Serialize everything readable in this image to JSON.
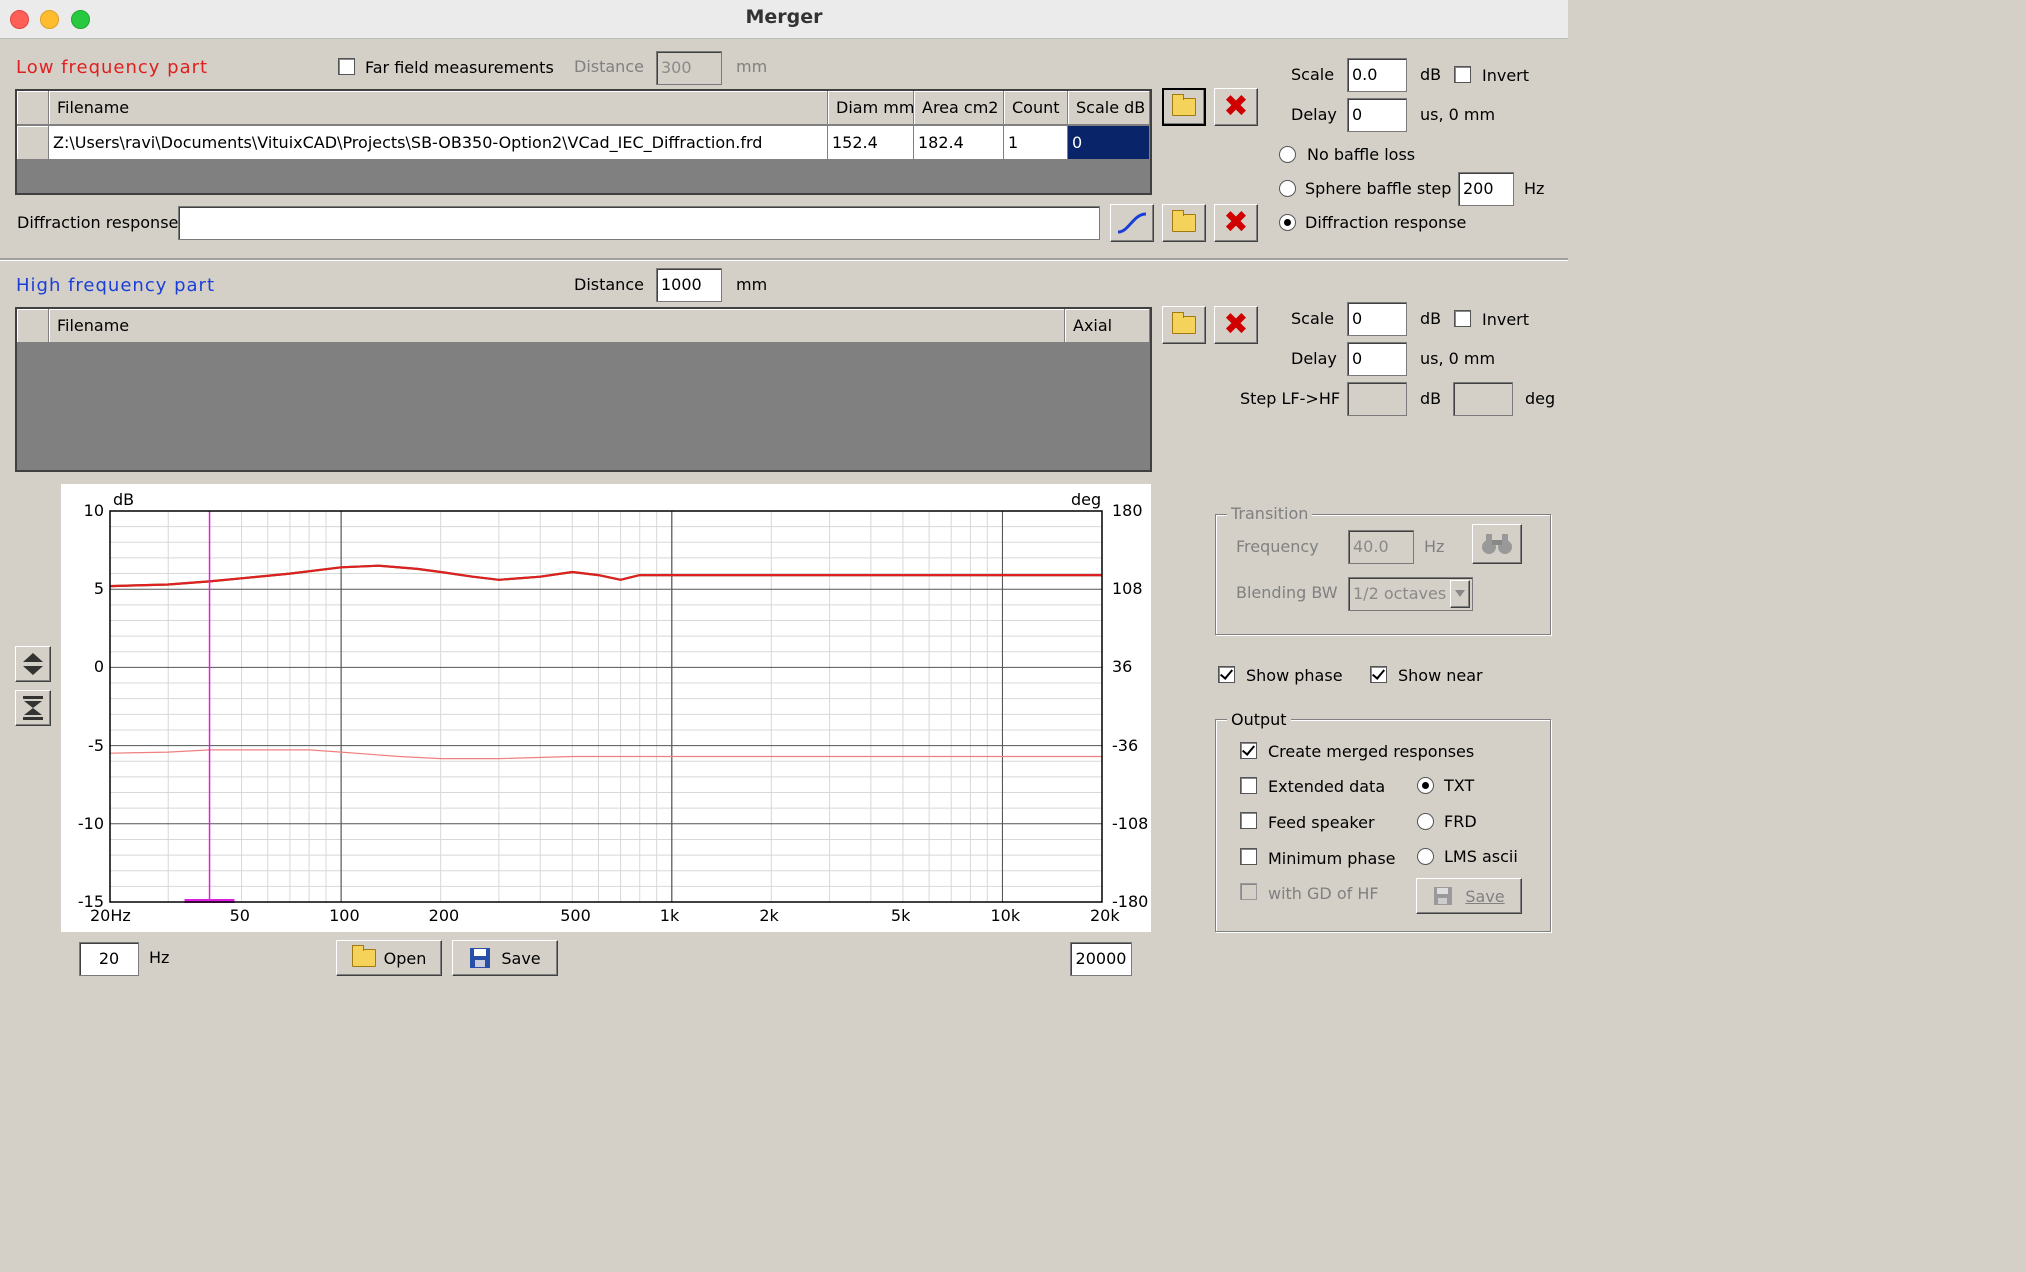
{
  "window": {
    "title": "Merger"
  },
  "lf": {
    "title": "Low frequency part",
    "far_field_label": "Far field measurements",
    "distance_label": "Distance",
    "distance_value": "300",
    "distance_unit": "mm",
    "grid": {
      "headers": [
        "Filename",
        "Diam mm",
        "Area cm2",
        "Count",
        "Scale dB"
      ],
      "row": [
        "Z:\\Users\\ravi\\Documents\\VituixCAD\\Projects\\SB-OB350-Option2\\VCad_IEC_Diffraction.frd",
        "152.4",
        "182.4",
        "1",
        "0"
      ]
    },
    "diffraction_label": "Diffraction response",
    "diffraction_value": "",
    "scale_label": "Scale",
    "scale_value": "0.0",
    "scale_unit": "dB",
    "invert_label": "Invert",
    "delay_label": "Delay",
    "delay_value": "0",
    "delay_unit": "us,  0 mm",
    "baffle_options": [
      "No baffle loss",
      "Sphere baffle step",
      "Diffraction response"
    ],
    "sphere_value": "200",
    "sphere_unit": "Hz"
  },
  "hf": {
    "title": "High frequency part",
    "distance_label": "Distance",
    "distance_value": "1000",
    "distance_unit": "mm",
    "grid": {
      "headers": [
        "Filename",
        "Axial"
      ]
    },
    "scale_label": "Scale",
    "scale_value": "0",
    "scale_unit": "dB",
    "invert_label": "Invert",
    "delay_label": "Delay",
    "delay_value": "0",
    "delay_unit": "us,  0 mm",
    "step_label": "Step LF->HF",
    "step_db_unit": "dB",
    "step_deg_unit": "deg"
  },
  "chart_data": {
    "type": "line",
    "ylabel": "dB",
    "y2label": "deg",
    "x_scale": "log",
    "xlim": [
      20,
      20000
    ],
    "ylim": [
      -15,
      10
    ],
    "y2lim": [
      -180,
      180
    ],
    "x_ticks": [
      "20Hz",
      "50",
      "100",
      "200",
      "500",
      "1k",
      "2k",
      "5k",
      "10k",
      "20k"
    ],
    "y_ticks": [
      "10",
      "5",
      "0",
      "-5",
      "-10",
      "-15"
    ],
    "y2_ticks": [
      "180",
      "108",
      "36",
      "-36",
      "-108",
      "-180"
    ],
    "transition_marker_hz": 40,
    "series": [
      {
        "color": "#2e7d2e",
        "x": [
          20,
          30,
          40,
          50,
          70,
          100,
          130,
          170,
          200,
          250,
          300,
          400,
          500,
          600,
          700,
          800,
          1000,
          1500,
          2000,
          3000,
          5000,
          10000,
          20000
        ],
        "y": [
          5.2,
          5.3,
          5.5,
          5.7,
          6.0,
          6.4,
          6.5,
          6.3,
          6.1,
          5.8,
          5.6,
          5.8,
          6.1,
          5.9,
          5.6,
          5.9,
          5.9,
          5.9,
          5.9,
          5.9,
          5.9,
          5.9,
          5.9
        ]
      },
      {
        "color": "#e02020",
        "x": [
          20,
          30,
          40,
          50,
          70,
          100,
          130,
          170,
          200,
          250,
          300,
          400,
          500,
          600,
          700,
          800,
          1000,
          1500,
          2000,
          3000,
          5000,
          10000,
          20000
        ],
        "y": [
          5.2,
          5.3,
          5.5,
          5.7,
          6.0,
          6.4,
          6.5,
          6.3,
          6.1,
          5.8,
          5.6,
          5.8,
          6.1,
          5.9,
          5.6,
          5.9,
          5.9,
          5.9,
          5.9,
          5.9,
          5.9,
          5.9,
          5.9
        ]
      },
      {
        "color": "#f08080",
        "axis": "y2",
        "x": [
          20,
          30,
          40,
          60,
          80,
          100,
          150,
          200,
          300,
          500,
          1000,
          2000,
          5000,
          10000,
          20000
        ],
        "y": [
          -43,
          -42,
          -40,
          -40,
          -40,
          -42,
          -46,
          -48,
          -48,
          -46,
          -46,
          -46,
          -46,
          -46,
          -46
        ]
      }
    ]
  },
  "chart_controls": {
    "min_value": "20",
    "min_unit": "Hz",
    "open_label": "Open",
    "save_label": "Save",
    "max_value": "20000"
  },
  "transition": {
    "title": "Transition",
    "frequency_label": "Frequency",
    "frequency_value": "40.0",
    "frequency_unit": "Hz",
    "blending_label": "Blending BW",
    "blending_value": "1/2 octaves"
  },
  "show_phase_label": "Show phase",
  "show_near_label": "Show near",
  "output": {
    "title": "Output",
    "create_merged": "Create merged responses",
    "extended": "Extended data",
    "feed": "Feed speaker",
    "minimum": "Minimum phase",
    "gd": "with GD of HF",
    "formats": [
      "TXT",
      "FRD",
      "LMS ascii"
    ],
    "save_label": "Save"
  }
}
